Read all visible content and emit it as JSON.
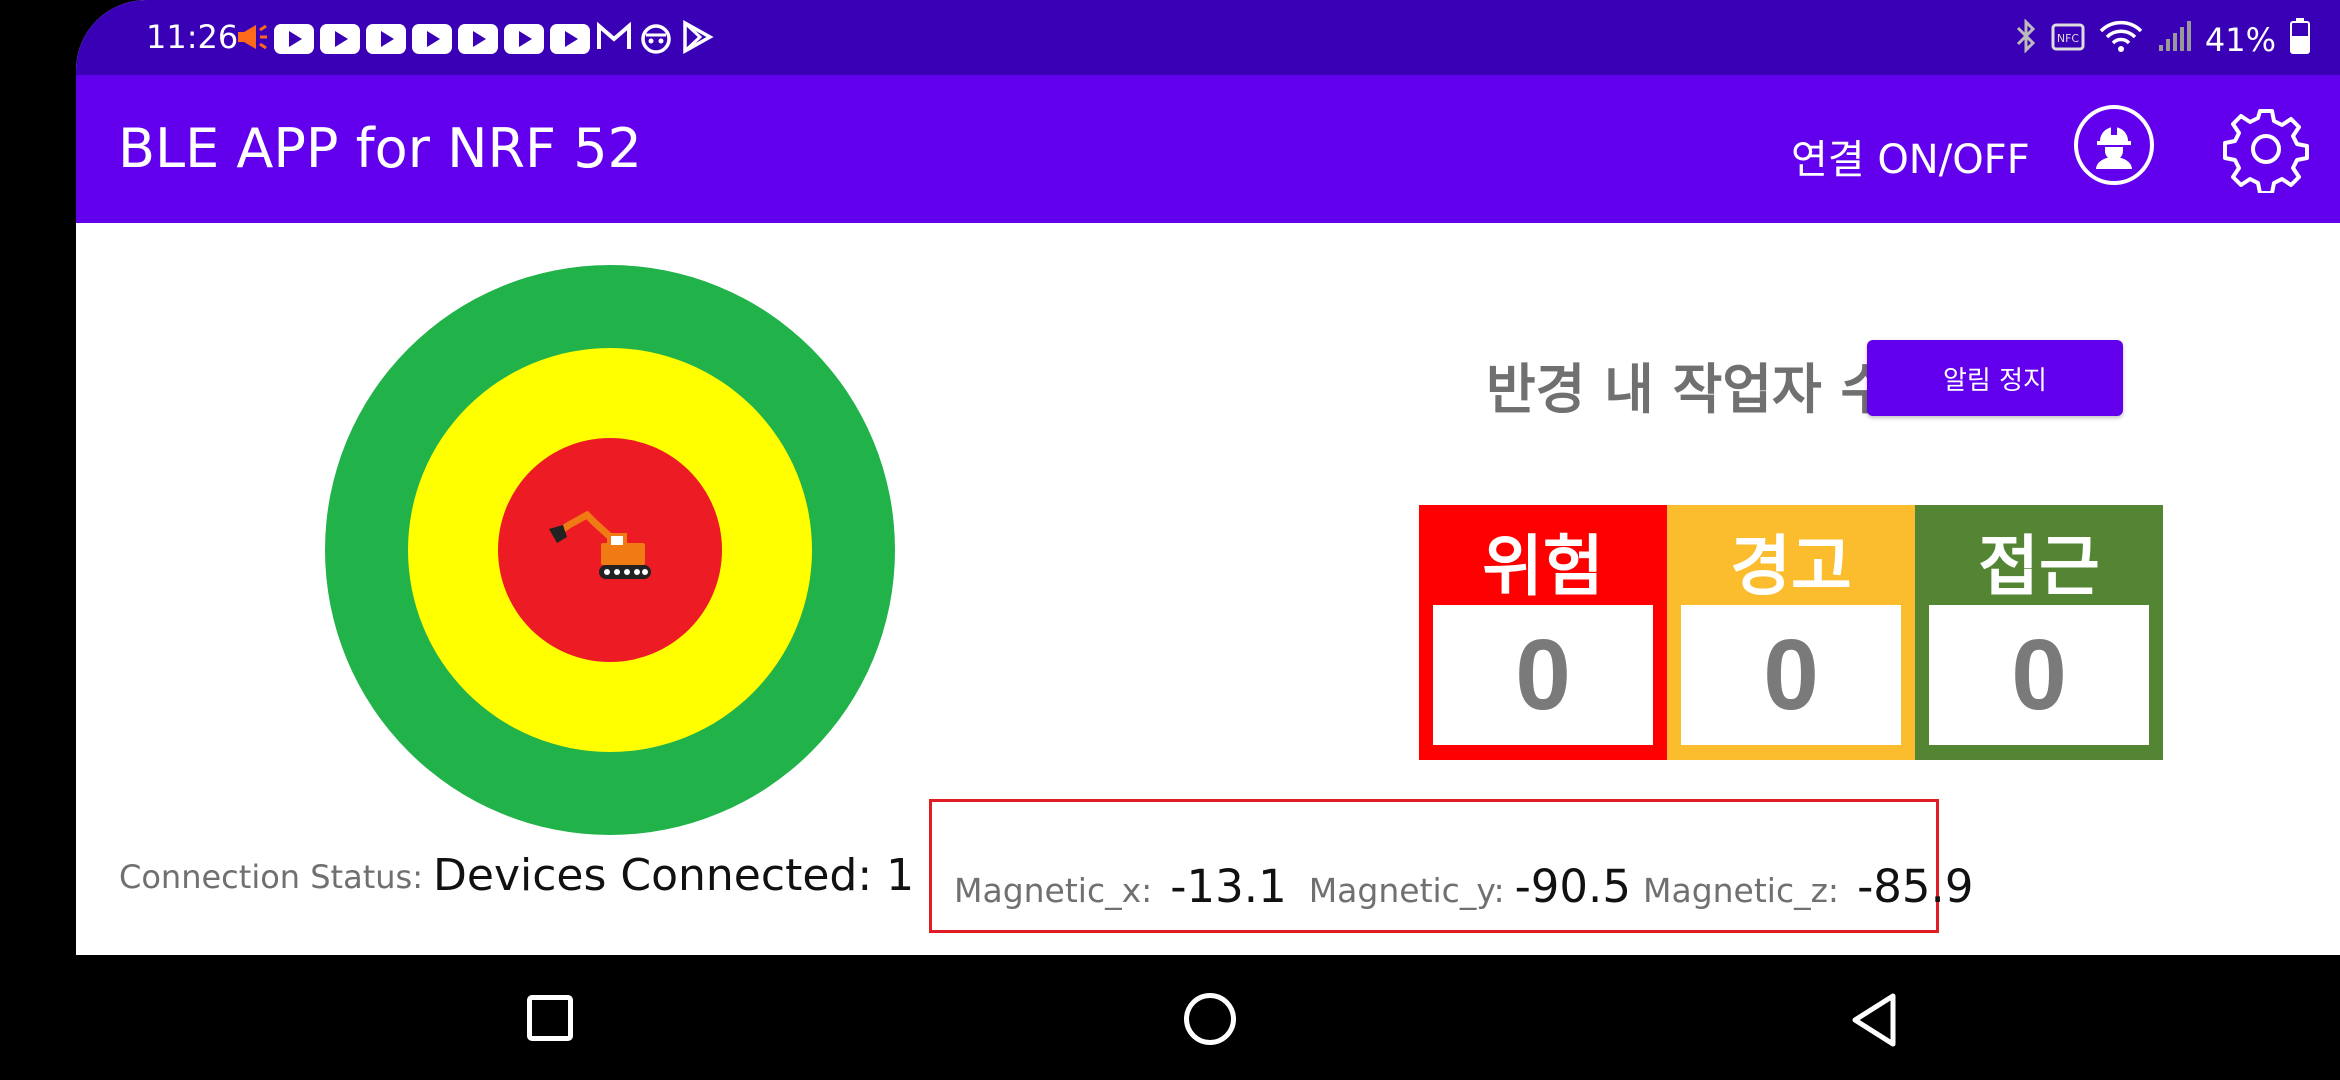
{
  "status_bar": {
    "time": "11:26",
    "battery": "41%"
  },
  "app_bar": {
    "title": "BLE APP for NRF 52",
    "connection_toggle": "연결 ON/OFF"
  },
  "main": {
    "workers_in_radius_title": "반경 내 작업자 수",
    "alarm_stop_label": "알림 정지",
    "counters": [
      {
        "label": "위험",
        "value": "0",
        "color": "#ff0000"
      },
      {
        "label": "경고",
        "value": "0",
        "color": "#fbbd2e"
      },
      {
        "label": "접근",
        "value": "0",
        "color": "#548533"
      }
    ],
    "radar": {
      "outer_color": "#21b24a",
      "middle_color": "#ffff00",
      "inner_color": "#ed1c24"
    }
  },
  "connection": {
    "label": "Connection Status:",
    "value": "Devices Connected: 1"
  },
  "magnetic": {
    "x_label": "Magnetic_x:",
    "x_value": "-13.1",
    "y_label": "Magnetic_y:",
    "y_value": "-90.5",
    "z_label": "Magnetic_z:",
    "z_value": "-85.9"
  }
}
